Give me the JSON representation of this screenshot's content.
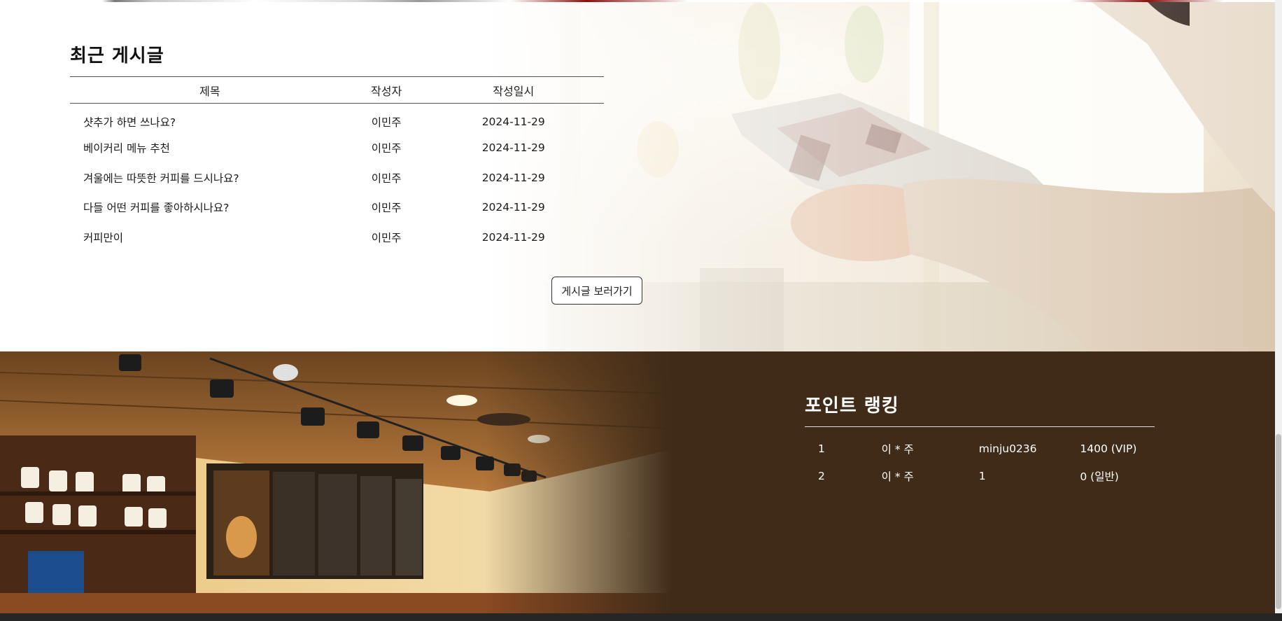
{
  "recent_posts": {
    "title": "최근 게시글",
    "columns": [
      "제목",
      "작성자",
      "작성일시"
    ],
    "rows": [
      {
        "title": "샷추가 하면 쓰나요?",
        "author": "이민주",
        "date": "2024-11-29"
      },
      {
        "title": "베이커리 메뉴 추천",
        "author": "이민주",
        "date": "2024-11-29"
      },
      {
        "title": "겨울에는 따뜻한 커피를 드시나요?",
        "author": "이민주",
        "date": "2024-11-29"
      },
      {
        "title": "다들 어떤 커피를 좋아하시나요?",
        "author": "이민주",
        "date": "2024-11-29"
      },
      {
        "title": "커피만이",
        "author": "이민주",
        "date": "2024-11-29"
      }
    ],
    "more_button": "게시글 보러가기"
  },
  "point_ranking": {
    "title": "포인트 랭킹",
    "rows": [
      {
        "rank": "1",
        "name": "이 * 주",
        "user_id": "minju0236",
        "points": "1400 (VIP)"
      },
      {
        "rank": "2",
        "name": "이 * 주",
        "user_id": "1",
        "points": "0 (일반)"
      }
    ]
  },
  "colors": {
    "ranking_background": "#3f2b18",
    "footer_bar": "#262626"
  }
}
